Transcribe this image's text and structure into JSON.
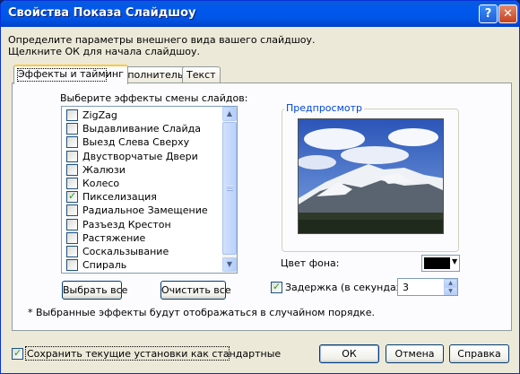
{
  "window": {
    "title": "Свойства Показа Слайдшоу",
    "help_glyph": "?",
    "close_glyph": "✕"
  },
  "intro": {
    "line1": "Определите параметры внешнего вида вашего слайдшоу.",
    "line2": "Щелкните ОК для начала слайдшоу."
  },
  "tabs": [
    {
      "label": "Эффекты и тайминг",
      "active": true
    },
    {
      "label": "Дополнительно",
      "active": false
    },
    {
      "label": "Текст",
      "active": false
    }
  ],
  "effects": {
    "heading": "Выберите эффекты смены слайдов:",
    "items": [
      {
        "label": "ZigZag",
        "checked": false
      },
      {
        "label": "Выдавливание Слайда",
        "checked": false
      },
      {
        "label": "Выезд Слева Сверху",
        "checked": false
      },
      {
        "label": "Двустворчатые Двери",
        "checked": false
      },
      {
        "label": "Жалюзи",
        "checked": false
      },
      {
        "label": "Колесо",
        "checked": false
      },
      {
        "label": "Пикселизация",
        "checked": true
      },
      {
        "label": "Радиальное Замещение",
        "checked": false
      },
      {
        "label": "Разъезд Крестон",
        "checked": false
      },
      {
        "label": "Растяжение",
        "checked": false
      },
      {
        "label": "Соскальзывание",
        "checked": false
      },
      {
        "label": "Спираль",
        "checked": false
      }
    ],
    "select_all": "Выбрать все",
    "clear_all": "Очистить все",
    "note": "* Выбранные эффекты будут отображаться в случайном порядке."
  },
  "preview": {
    "title": "Предпросмотр"
  },
  "background": {
    "label": "Цвет фона:",
    "color": "#000000"
  },
  "delay": {
    "label": "Задержка (в секундах):",
    "checked": true,
    "value": "3"
  },
  "footer": {
    "save_defaults": "Сохранить текущие установки как стандартные",
    "save_defaults_checked": true,
    "ok": "ОК",
    "cancel": "Отмена",
    "help": "Справка"
  }
}
